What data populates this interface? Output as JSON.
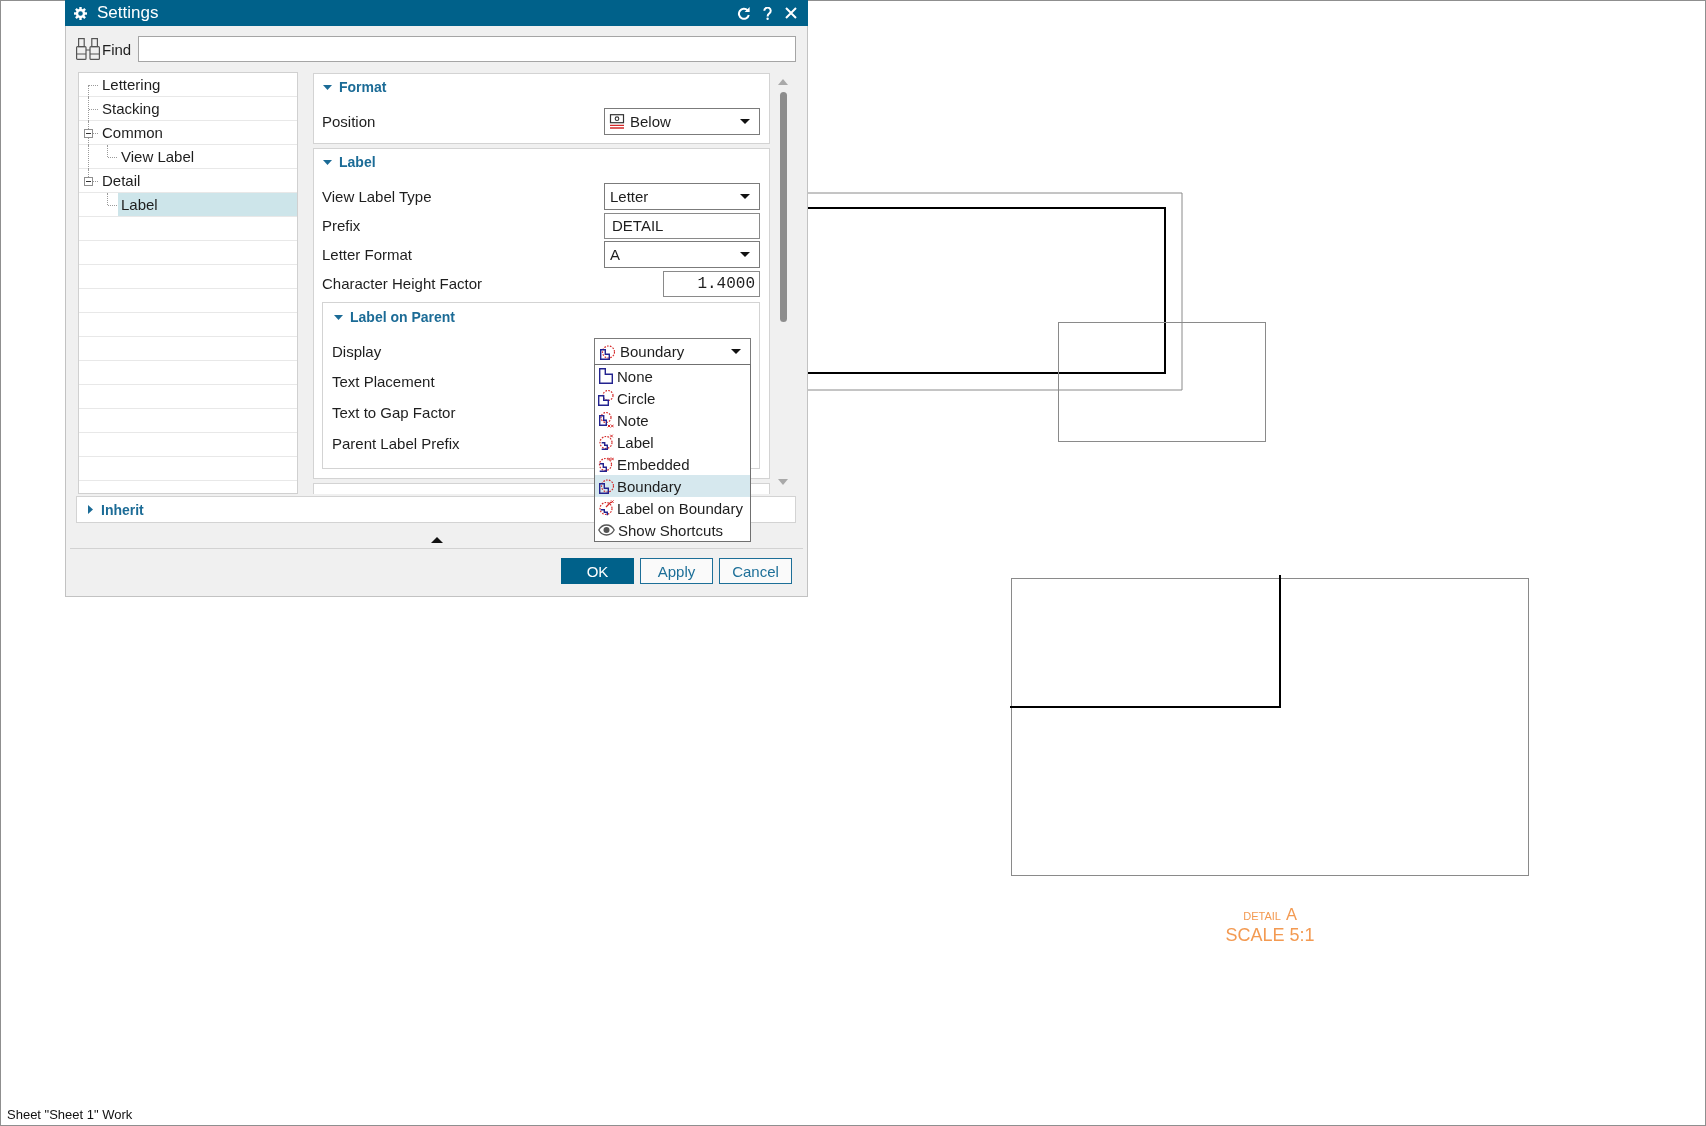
{
  "window": {
    "title": "Settings"
  },
  "find": {
    "label": "Find"
  },
  "tree": [
    {
      "label": "Lettering",
      "selected": false
    },
    {
      "label": "Stacking",
      "selected": false
    },
    {
      "label": "Common",
      "selected": false,
      "expanded": true,
      "children": [
        {
          "label": "View Label",
          "selected": false
        }
      ]
    },
    {
      "label": "Detail",
      "selected": false,
      "expanded": true,
      "children": [
        {
          "label": "Label",
          "selected": true
        }
      ]
    }
  ],
  "sections": [
    {
      "title": "Format",
      "expanded": true,
      "fields": [
        {
          "kind": "iconselect",
          "label": "Position",
          "value": "Below"
        }
      ]
    },
    {
      "title": "Label",
      "expanded": true,
      "fields": [
        {
          "kind": "select",
          "label": "View Label Type",
          "value": "Letter"
        },
        {
          "kind": "text",
          "label": "Prefix",
          "value": "DETAIL"
        },
        {
          "kind": "select",
          "label": "Letter Format",
          "value": "A"
        },
        {
          "kind": "number",
          "label": "Character Height Factor",
          "value": "1.4000"
        },
        {
          "kind": "group",
          "title": "Label on Parent",
          "expanded": true,
          "fields": [
            {
              "kind": "iconselect",
              "label": "Display",
              "value": "Boundary",
              "open": true,
              "options": [
                {
                  "label": "None",
                  "selected": false
                },
                {
                  "label": "Circle",
                  "selected": false
                },
                {
                  "label": "Note",
                  "selected": false
                },
                {
                  "label": "Label",
                  "selected": false
                },
                {
                  "label": "Embedded",
                  "selected": false
                },
                {
                  "label": "Boundary",
                  "selected": true
                },
                {
                  "label": "Label on Boundary",
                  "selected": false
                },
                {
                  "label": "Show Shortcuts",
                  "selected": false
                }
              ]
            },
            {
              "kind": "label",
              "label": "Text Placement"
            },
            {
              "kind": "label",
              "label": "Text to Gap Factor"
            },
            {
              "kind": "label",
              "label": "Parent Label Prefix"
            }
          ]
        }
      ]
    }
  ],
  "inherit": {
    "title": "Inherit",
    "expanded": false
  },
  "buttons": [
    {
      "label": "OK",
      "default": true
    },
    {
      "label": "Apply",
      "default": false
    },
    {
      "label": "Cancel",
      "default": false
    }
  ],
  "drawing": {
    "label_prefix": "DETAIL",
    "label_letter": "A",
    "scale": "SCALE 5:1"
  },
  "status_bar": "Sheet \"Sheet 1\" Work"
}
